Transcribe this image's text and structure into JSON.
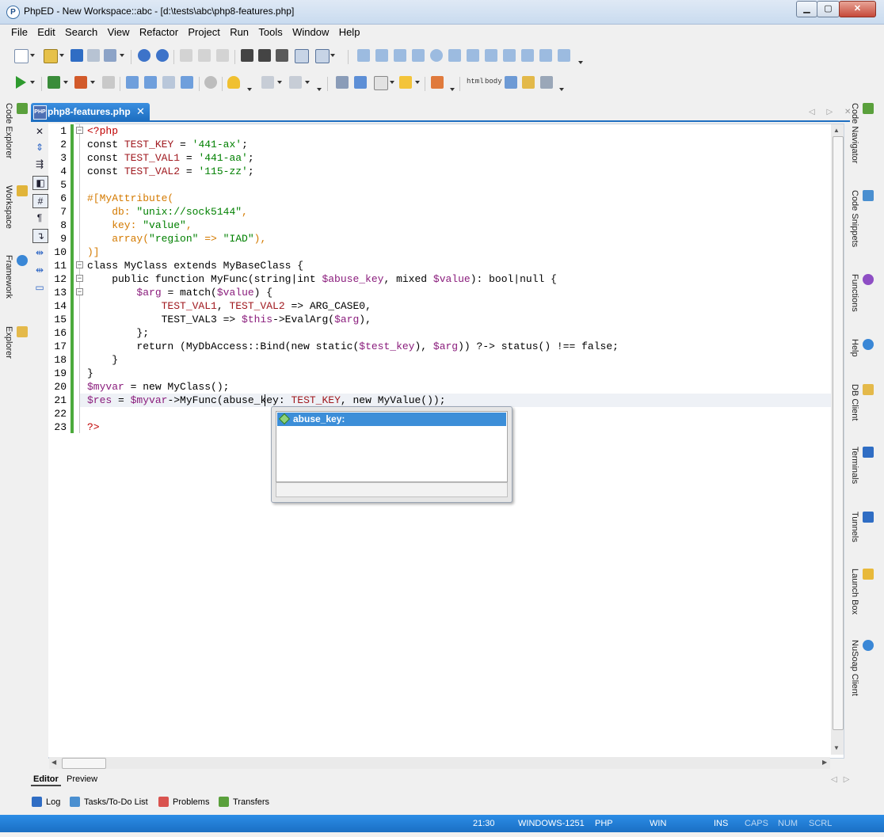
{
  "window": {
    "title": "PhpED - New Workspace::abc - [d:\\tests\\abc\\php8-features.php]",
    "app_icon": "P"
  },
  "menu": [
    "File",
    "Edit",
    "Search",
    "View",
    "Refactor",
    "Project",
    "Run",
    "Tools",
    "Window",
    "Help"
  ],
  "toolbar2_text": {
    "html": "html",
    "body": "body"
  },
  "left_panels": [
    "Code Explorer",
    "Workspace",
    "Framework",
    "Explorer"
  ],
  "right_panels": [
    "Code Navigator",
    "Code Snippets",
    "Functions",
    "Help",
    "DB Client",
    "Terminals",
    "Tunnels",
    "Launch Box",
    "NuSoap Client"
  ],
  "editor_tab": {
    "label": "php8-features.php",
    "icon_text": "PHP",
    "close": "✕"
  },
  "tab_nav": "◁ ▷ ✕",
  "line_numbers": [
    "1",
    "2",
    "3",
    "4",
    "5",
    "6",
    "7",
    "8",
    "9",
    "10",
    "11",
    "12",
    "13",
    "14",
    "15",
    "16",
    "17",
    "18",
    "19",
    "20",
    "21",
    "22",
    "23"
  ],
  "autocomplete": {
    "item": "abuse_key:"
  },
  "sub_tabs": {
    "editor": "Editor",
    "preview": "Preview"
  },
  "panel_tabs": [
    {
      "label": "Log"
    },
    {
      "label": "Tasks/To-Do List"
    },
    {
      "label": "Problems"
    },
    {
      "label": "Transfers"
    }
  ],
  "status": {
    "position": "21:30",
    "encoding": "WINDOWS-1251",
    "language": "PHP",
    "eol": "WIN",
    "ins": "INS",
    "caps": "CAPS",
    "num": "NUM",
    "scrl": "SCRL"
  }
}
